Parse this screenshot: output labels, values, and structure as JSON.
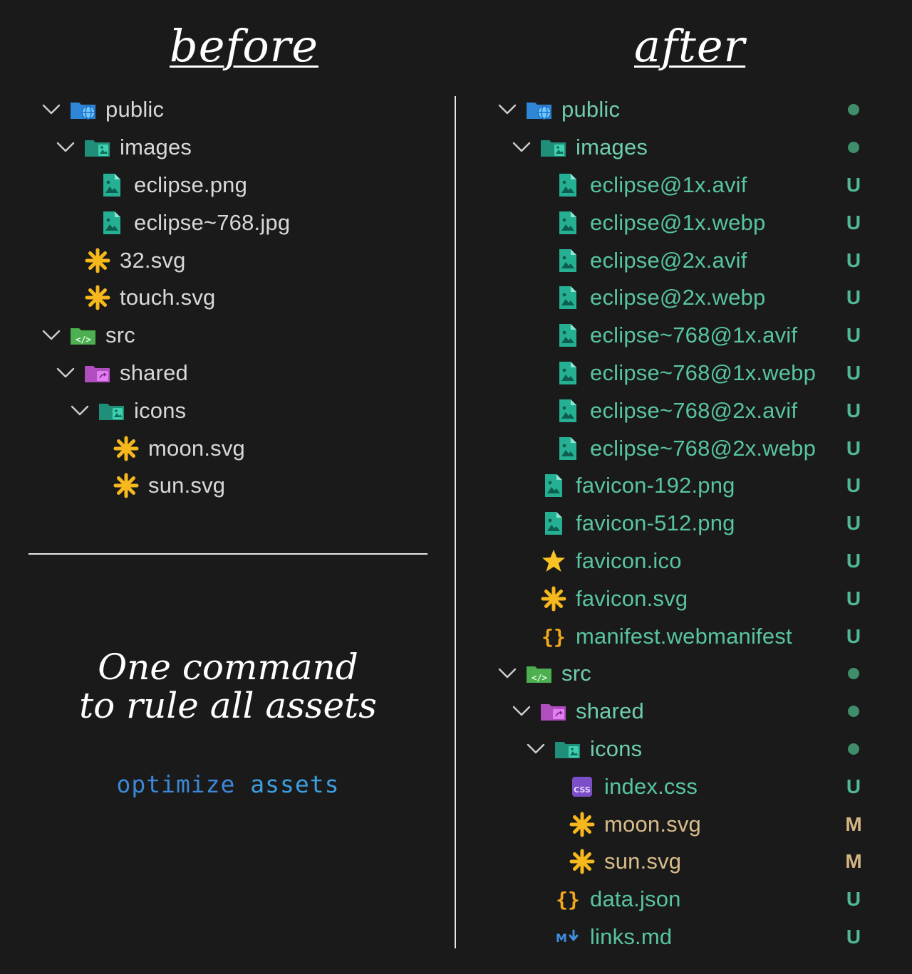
{
  "headings": {
    "before": "before",
    "after": "after"
  },
  "tagline": {
    "line1": "One command",
    "line2": "to rule all assets"
  },
  "command": {
    "word1": "optimize",
    "word2": "assets"
  },
  "colors": {
    "background": "#1a1a1a",
    "untracked_text": "#58c4a2",
    "modified_text": "#d9bd8a",
    "command_blue": "#3d88d6",
    "svg_icon": "#f6b81c",
    "image_icon": "#2bb39a"
  },
  "before_tree": [
    {
      "label": "public",
      "depth": 0,
      "icon": "folder-public-icon",
      "chevron": true
    },
    {
      "label": "images",
      "depth": 1,
      "icon": "folder-images-icon",
      "chevron": true
    },
    {
      "label": "eclipse.png",
      "depth": 2,
      "icon": "image-file-icon"
    },
    {
      "label": "eclipse~768.jpg",
      "depth": 2,
      "icon": "image-file-icon"
    },
    {
      "label": "32.svg",
      "depth": 1,
      "icon": "svg-file-icon"
    },
    {
      "label": "touch.svg",
      "depth": 1,
      "icon": "svg-file-icon"
    },
    {
      "label": "src",
      "depth": 0,
      "icon": "folder-src-icon",
      "chevron": true
    },
    {
      "label": "shared",
      "depth": 1,
      "icon": "folder-shared-icon",
      "chevron": true
    },
    {
      "label": "icons",
      "depth": 2,
      "icon": "folder-images-icon",
      "chevron": true
    },
    {
      "label": "moon.svg",
      "depth": 3,
      "icon": "svg-file-icon"
    },
    {
      "label": "sun.svg",
      "depth": 3,
      "icon": "svg-file-icon"
    }
  ],
  "after_tree": [
    {
      "label": "public",
      "depth": 0,
      "icon": "folder-public-icon",
      "chevron": true,
      "status": "dot",
      "tone": "n"
    },
    {
      "label": "images",
      "depth": 1,
      "icon": "folder-images-icon",
      "chevron": true,
      "status": "dot",
      "tone": "n"
    },
    {
      "label": "eclipse@1x.avif",
      "depth": 2,
      "icon": "image-file-icon",
      "status": "U",
      "tone": "u"
    },
    {
      "label": "eclipse@1x.webp",
      "depth": 2,
      "icon": "image-file-icon",
      "status": "U",
      "tone": "u"
    },
    {
      "label": "eclipse@2x.avif",
      "depth": 2,
      "icon": "image-file-icon",
      "status": "U",
      "tone": "u"
    },
    {
      "label": "eclipse@2x.webp",
      "depth": 2,
      "icon": "image-file-icon",
      "status": "U",
      "tone": "u"
    },
    {
      "label": "eclipse~768@1x.avif",
      "depth": 2,
      "icon": "image-file-icon",
      "status": "U",
      "tone": "u"
    },
    {
      "label": "eclipse~768@1x.webp",
      "depth": 2,
      "icon": "image-file-icon",
      "status": "U",
      "tone": "u"
    },
    {
      "label": "eclipse~768@2x.avif",
      "depth": 2,
      "icon": "image-file-icon",
      "status": "U",
      "tone": "u"
    },
    {
      "label": "eclipse~768@2x.webp",
      "depth": 2,
      "icon": "image-file-icon",
      "status": "U",
      "tone": "u"
    },
    {
      "label": "favicon-192.png",
      "depth": 1,
      "icon": "image-file-icon",
      "status": "U",
      "tone": "u"
    },
    {
      "label": "favicon-512.png",
      "depth": 1,
      "icon": "image-file-icon",
      "status": "U",
      "tone": "u"
    },
    {
      "label": "favicon.ico",
      "depth": 1,
      "icon": "star-icon",
      "status": "U",
      "tone": "u"
    },
    {
      "label": "favicon.svg",
      "depth": 1,
      "icon": "svg-file-icon",
      "status": "U",
      "tone": "u"
    },
    {
      "label": "manifest.webmanifest",
      "depth": 1,
      "icon": "json-braces-icon",
      "status": "U",
      "tone": "u"
    },
    {
      "label": "src",
      "depth": 0,
      "icon": "folder-src-icon",
      "chevron": true,
      "status": "dot",
      "tone": "n"
    },
    {
      "label": "shared",
      "depth": 1,
      "icon": "folder-shared-icon",
      "chevron": true,
      "status": "dot",
      "tone": "n"
    },
    {
      "label": "icons",
      "depth": 2,
      "icon": "folder-images-icon",
      "chevron": true,
      "status": "dot",
      "tone": "n"
    },
    {
      "label": "index.css",
      "depth": 3,
      "icon": "css-file-icon",
      "status": "U",
      "tone": "u"
    },
    {
      "label": "moon.svg",
      "depth": 3,
      "icon": "svg-file-icon",
      "status": "M",
      "tone": "m"
    },
    {
      "label": "sun.svg",
      "depth": 3,
      "icon": "svg-file-icon",
      "status": "M",
      "tone": "m"
    },
    {
      "label": "data.json",
      "depth": 2,
      "icon": "json-braces-icon",
      "status": "U",
      "tone": "u"
    },
    {
      "label": "links.md",
      "depth": 2,
      "icon": "markdown-file-icon",
      "status": "U",
      "tone": "u"
    }
  ]
}
